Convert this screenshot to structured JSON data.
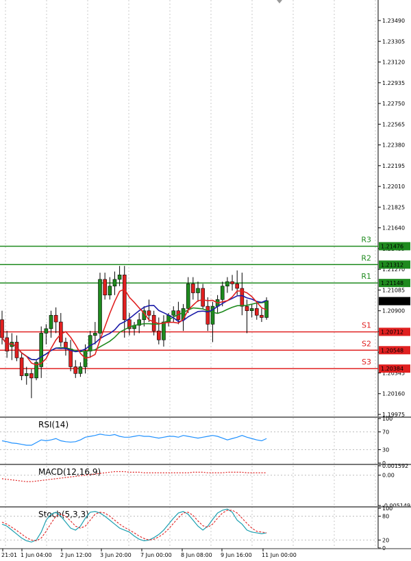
{
  "chart_data": {
    "type": "candlestick",
    "price_axis": {
      "ticks": [
        "1.23490",
        "1.23305",
        "1.23120",
        "1.22935",
        "1.22750",
        "1.22565",
        "1.22380",
        "1.22195",
        "1.22010",
        "1.21825",
        "1.21640",
        "1.21455",
        "1.21270",
        "1.21085",
        "1.20900",
        "1.20715",
        "1.20530",
        "1.20345",
        "1.20160",
        "1.19975"
      ],
      "range": [
        1.19975,
        1.2364
      ]
    },
    "time_axis": {
      "labels": [
        "21:01",
        "1 Jun 04:00",
        "2 Jun 12:00",
        "3 Jun 20:00",
        "7 Jun 00:00",
        "8 Jun 08:00",
        "9 Jun 16:00",
        "11 Jun 00:00"
      ]
    },
    "levels": [
      {
        "name": "R3",
        "value": "1.21476",
        "color": "#1e8a1e"
      },
      {
        "name": "R2",
        "value": "1.21312",
        "color": "#1e8a1e"
      },
      {
        "name": "R1",
        "value": "1.21148",
        "color": "#1e8a1e"
      },
      {
        "name": "S1",
        "value": "1.20712",
        "color": "#e02020"
      },
      {
        "name": "S2",
        "value": "1.20548",
        "color": "#e02020"
      },
      {
        "name": "S3",
        "value": "1.20384",
        "color": "#e02020"
      }
    ],
    "current_price": {
      "value": "1.20986"
    },
    "candles": [
      {
        "o": 1.2082,
        "h": 1.209,
        "l": 1.206,
        "c": 1.2066
      },
      {
        "o": 1.2066,
        "h": 1.2072,
        "l": 1.2048,
        "c": 1.2054
      },
      {
        "o": 1.2058,
        "h": 1.207,
        "l": 1.2046,
        "c": 1.2062
      },
      {
        "o": 1.2062,
        "h": 1.2068,
        "l": 1.2045,
        "c": 1.2048
      },
      {
        "o": 1.2048,
        "h": 1.2052,
        "l": 1.2028,
        "c": 1.2032
      },
      {
        "o": 1.2032,
        "h": 1.204,
        "l": 1.2024,
        "c": 1.2034
      },
      {
        "o": 1.2034,
        "h": 1.2038,
        "l": 1.2012,
        "c": 1.203
      },
      {
        "o": 1.203,
        "h": 1.2046,
        "l": 1.2028,
        "c": 1.2044
      },
      {
        "o": 1.204,
        "h": 1.2076,
        "l": 1.203,
        "c": 1.207
      },
      {
        "o": 1.207,
        "h": 1.2078,
        "l": 1.206,
        "c": 1.2074
      },
      {
        "o": 1.2074,
        "h": 1.209,
        "l": 1.2066,
        "c": 1.2086
      },
      {
        "o": 1.2086,
        "h": 1.2093,
        "l": 1.207,
        "c": 1.208
      },
      {
        "o": 1.208,
        "h": 1.2088,
        "l": 1.2058,
        "c": 1.2062
      },
      {
        "o": 1.2062,
        "h": 1.2066,
        "l": 1.205,
        "c": 1.2056
      },
      {
        "o": 1.2056,
        "h": 1.2064,
        "l": 1.2036,
        "c": 1.204
      },
      {
        "o": 1.204,
        "h": 1.2046,
        "l": 1.203,
        "c": 1.2034
      },
      {
        "o": 1.2034,
        "h": 1.2044,
        "l": 1.2031,
        "c": 1.204
      },
      {
        "o": 1.204,
        "h": 1.206,
        "l": 1.2034,
        "c": 1.2054
      },
      {
        "o": 1.2054,
        "h": 1.2072,
        "l": 1.2048,
        "c": 1.2068
      },
      {
        "o": 1.2068,
        "h": 1.208,
        "l": 1.206,
        "c": 1.207
      },
      {
        "o": 1.207,
        "h": 1.2124,
        "l": 1.2064,
        "c": 1.2118
      },
      {
        "o": 1.2118,
        "h": 1.2124,
        "l": 1.21,
        "c": 1.2104
      },
      {
        "o": 1.2104,
        "h": 1.212,
        "l": 1.21,
        "c": 1.2112
      },
      {
        "o": 1.2112,
        "h": 1.2125,
        "l": 1.2104,
        "c": 1.2118
      },
      {
        "o": 1.2118,
        "h": 1.213,
        "l": 1.2112,
        "c": 1.2122
      },
      {
        "o": 1.2122,
        "h": 1.213,
        "l": 1.2066,
        "c": 1.2082
      },
      {
        "o": 1.2082,
        "h": 1.2088,
        "l": 1.2068,
        "c": 1.2074
      },
      {
        "o": 1.2074,
        "h": 1.208,
        "l": 1.2068,
        "c": 1.2077
      },
      {
        "o": 1.2077,
        "h": 1.2088,
        "l": 1.207,
        "c": 1.2082
      },
      {
        "o": 1.2082,
        "h": 1.2094,
        "l": 1.2076,
        "c": 1.209
      },
      {
        "o": 1.209,
        "h": 1.21,
        "l": 1.208,
        "c": 1.2086
      },
      {
        "o": 1.2086,
        "h": 1.209,
        "l": 1.2068,
        "c": 1.2072
      },
      {
        "o": 1.2072,
        "h": 1.2084,
        "l": 1.206,
        "c": 1.2064
      },
      {
        "o": 1.2064,
        "h": 1.2086,
        "l": 1.2058,
        "c": 1.208
      },
      {
        "o": 1.208,
        "h": 1.2088,
        "l": 1.2076,
        "c": 1.2086
      },
      {
        "o": 1.2086,
        "h": 1.2094,
        "l": 1.208,
        "c": 1.209
      },
      {
        "o": 1.209,
        "h": 1.2098,
        "l": 1.2078,
        "c": 1.2082
      },
      {
        "o": 1.2082,
        "h": 1.2096,
        "l": 1.2072,
        "c": 1.2092
      },
      {
        "o": 1.2092,
        "h": 1.212,
        "l": 1.2088,
        "c": 1.2114
      },
      {
        "o": 1.2114,
        "h": 1.212,
        "l": 1.21,
        "c": 1.2106
      },
      {
        "o": 1.2106,
        "h": 1.2116,
        "l": 1.2098,
        "c": 1.211
      },
      {
        "o": 1.211,
        "h": 1.2114,
        "l": 1.2092,
        "c": 1.2094
      },
      {
        "o": 1.2094,
        "h": 1.2102,
        "l": 1.2072,
        "c": 1.2078
      },
      {
        "o": 1.2078,
        "h": 1.2098,
        "l": 1.2062,
        "c": 1.2094
      },
      {
        "o": 1.2094,
        "h": 1.2104,
        "l": 1.2088,
        "c": 1.21
      },
      {
        "o": 1.21,
        "h": 1.2116,
        "l": 1.2094,
        "c": 1.2112
      },
      {
        "o": 1.2112,
        "h": 1.212,
        "l": 1.2106,
        "c": 1.2116
      },
      {
        "o": 1.2116,
        "h": 1.2122,
        "l": 1.2108,
        "c": 1.2114
      },
      {
        "o": 1.2114,
        "h": 1.2126,
        "l": 1.2104,
        "c": 1.211
      },
      {
        "o": 1.211,
        "h": 1.2124,
        "l": 1.2086,
        "c": 1.2094
      },
      {
        "o": 1.2094,
        "h": 1.21,
        "l": 1.207,
        "c": 1.209
      },
      {
        "o": 1.209,
        "h": 1.2096,
        "l": 1.2084,
        "c": 1.2092
      },
      {
        "o": 1.2092,
        "h": 1.2098,
        "l": 1.2082,
        "c": 1.2086
      },
      {
        "o": 1.2086,
        "h": 1.2092,
        "l": 1.208,
        "c": 1.2084
      },
      {
        "o": 1.2084,
        "h": 1.2102,
        "l": 1.2082,
        "c": 1.2099
      }
    ],
    "indicators": [
      {
        "name": "RSI(14)",
        "axis_ticks": [
          "100",
          "70",
          "30",
          "0"
        ],
        "range": [
          0,
          100
        ]
      },
      {
        "name": "MACD(12,16,9)",
        "axis_ticks": [
          "0.001592",
          "0.00",
          "-0.005149"
        ],
        "range": [
          -0.005149,
          0.001592
        ]
      },
      {
        "name": "Stoch(5,3,3)",
        "axis_ticks": [
          "100",
          "80",
          "20",
          "0"
        ],
        "range": [
          0,
          100
        ]
      }
    ],
    "rsi": [
      50,
      48,
      45,
      44,
      42,
      40,
      40,
      46,
      52,
      50,
      52,
      55,
      50,
      48,
      47,
      48,
      52,
      58,
      60,
      62,
      65,
      63,
      62,
      64,
      60,
      58,
      58,
      60,
      62,
      60,
      60,
      58,
      56,
      58,
      60,
      60,
      58,
      62,
      60,
      58,
      56,
      58,
      60,
      62,
      60,
      56,
      52,
      55,
      58,
      62,
      58,
      55,
      52,
      50,
      55
    ],
    "macd": [
      -0.0006,
      -0.0007,
      -0.0008,
      -0.0009,
      -0.001,
      -0.0011,
      -0.0011,
      -0.001,
      -0.0009,
      -0.0008,
      -0.0007,
      -0.0006,
      -0.0005,
      -0.0004,
      -0.0003,
      -0.0002,
      -0.0001,
      0.0,
      0.0001,
      0.0002,
      0.0003,
      0.0004,
      0.0005,
      0.0006,
      0.0006,
      0.0006,
      0.0005,
      0.0005,
      0.0005,
      0.0004,
      0.0004,
      0.0004,
      0.0004,
      0.0004,
      0.0004,
      0.0004,
      0.0004,
      0.0004,
      0.0004,
      0.0005,
      0.0005,
      0.0005,
      0.0004,
      0.0004,
      0.0004,
      0.0004,
      0.0005,
      0.0005,
      0.0005,
      0.0005,
      0.0004,
      0.0004,
      0.0004,
      0.0004,
      0.0004
    ],
    "stoch_k": [
      60,
      55,
      45,
      35,
      25,
      18,
      15,
      20,
      40,
      70,
      85,
      90,
      80,
      65,
      50,
      45,
      55,
      75,
      90,
      92,
      88,
      80,
      70,
      60,
      50,
      45,
      40,
      30,
      22,
      18,
      20,
      26,
      34,
      45,
      60,
      75,
      88,
      92,
      85,
      70,
      55,
      45,
      55,
      72,
      88,
      95,
      98,
      90,
      70,
      60,
      45,
      40,
      38,
      36,
      38
    ],
    "stoch_d": [
      65,
      60,
      52,
      44,
      35,
      26,
      20,
      18,
      25,
      42,
      62,
      80,
      85,
      80,
      68,
      55,
      50,
      55,
      70,
      85,
      90,
      88,
      80,
      70,
      60,
      52,
      45,
      38,
      30,
      24,
      20,
      22,
      28,
      36,
      48,
      62,
      76,
      88,
      90,
      82,
      68,
      56,
      52,
      60,
      75,
      88,
      95,
      95,
      88,
      75,
      62,
      50,
      42,
      40,
      38
    ]
  }
}
